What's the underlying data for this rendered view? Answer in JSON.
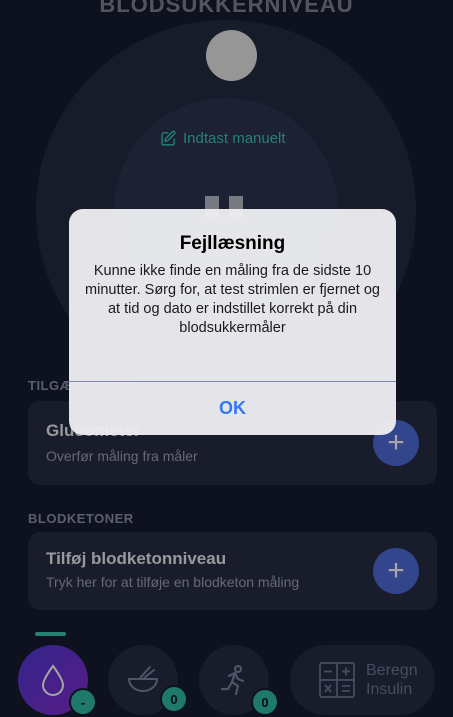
{
  "header": {
    "title": "BLODSUKKERNIVEAU"
  },
  "gauge": {
    "manual_entry_label": "Indtast manuelt",
    "manual_entry_icon": "edit-icon",
    "value_placeholder": "- -"
  },
  "sections": {
    "transfer_label": "TILGÆNGELIGE",
    "glucometer": {
      "title": "Glucometer",
      "subtitle": "Overfør måling fra måler",
      "action_icon": "plus-icon"
    },
    "ketones_label": "BLODKETONER",
    "ketones": {
      "title": "Tilføj blodketonniveau",
      "subtitle": "Tryk her for at tilføje en blodketon måling",
      "action_icon": "plus-icon"
    }
  },
  "bottom_nav": {
    "glucose": {
      "icon": "drop-icon",
      "badge": "-"
    },
    "food": {
      "icon": "bowl-icon",
      "badge": "0"
    },
    "activity": {
      "icon": "running-icon",
      "badge": "0"
    },
    "calculate": {
      "icon": "calculator-icon",
      "label_line1": "Beregn",
      "label_line2": "Insulin"
    }
  },
  "alert": {
    "title": "Fejllæsning",
    "message": "Kunne ikke finde en måling fra de sidste 10 minutter. Sørg for, at test strimlen er fjernet og at tid og dato er indstillet korrekt på din blodsukkermåler",
    "ok_label": "OK"
  },
  "colors": {
    "background": "#161b2e",
    "card": "#262c43",
    "accent_teal": "#3bc5b3",
    "accent_blue": "#4f6bd8",
    "alert_button": "#3478f6"
  }
}
